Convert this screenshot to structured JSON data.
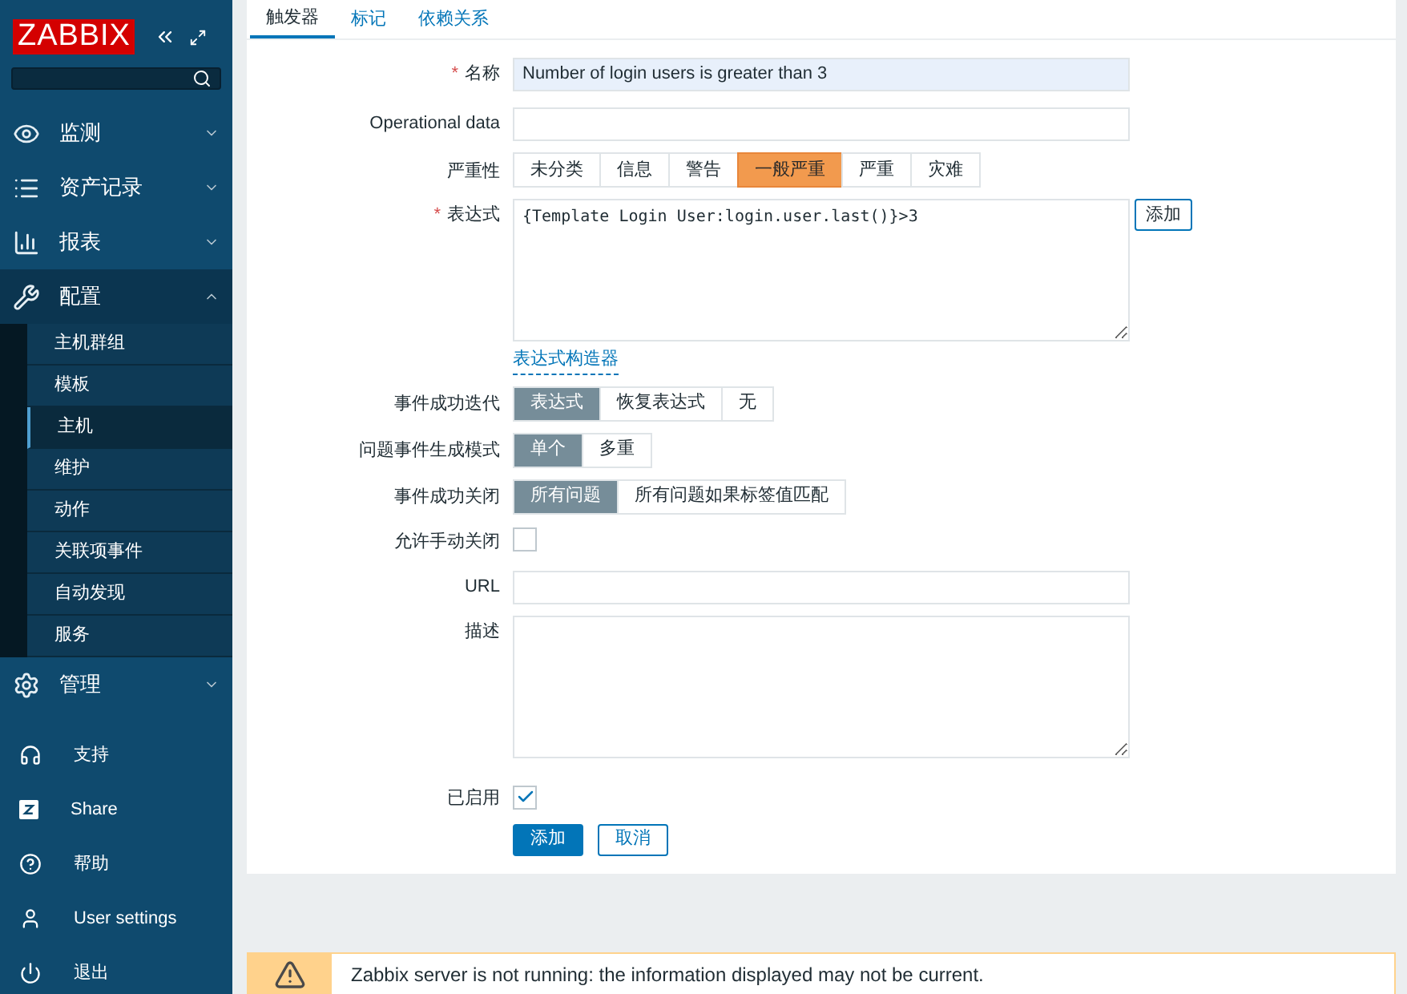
{
  "sidebar": {
    "logo": "ZABBIX",
    "menu": [
      {
        "label": "监测",
        "expanded": false
      },
      {
        "label": "资产记录",
        "expanded": false
      },
      {
        "label": "报表",
        "expanded": false
      },
      {
        "label": "配置",
        "expanded": true,
        "children": [
          {
            "label": "主机群组",
            "selected": false
          },
          {
            "label": "模板",
            "selected": false
          },
          {
            "label": "主机",
            "selected": true
          },
          {
            "label": "维护",
            "selected": false
          },
          {
            "label": "动作",
            "selected": false
          },
          {
            "label": "关联项事件",
            "selected": false
          },
          {
            "label": "自动发现",
            "selected": false
          },
          {
            "label": "服务",
            "selected": false
          }
        ]
      },
      {
        "label": "管理",
        "expanded": false
      }
    ],
    "footer": [
      {
        "label": "支持"
      },
      {
        "label": "Share"
      },
      {
        "label": "帮助"
      },
      {
        "label": "User settings"
      },
      {
        "label": "退出"
      }
    ]
  },
  "tabs": [
    {
      "label": "触发器",
      "selected": true
    },
    {
      "label": "标记",
      "selected": false
    },
    {
      "label": "依赖关系",
      "selected": false
    }
  ],
  "form": [
    {
      "kind": "text",
      "label": "名称",
      "required_mark": "*",
      "value": "Number of login users is greater than 3",
      "focused": true
    },
    {
      "kind": "text",
      "label": "Operational data",
      "focused": false
    },
    {
      "kind": "severity",
      "label": "严重性",
      "options": [
        {
          "label": "未分类",
          "selected": false
        },
        {
          "label": "信息",
          "selected": false
        },
        {
          "label": "警告",
          "selected": false
        },
        {
          "label": "一般严重",
          "selected": true
        },
        {
          "label": "严重",
          "selected": false
        },
        {
          "label": "灾难",
          "selected": false
        }
      ]
    },
    {
      "kind": "expression",
      "label": "表达式",
      "required_mark": "*",
      "value": "{Template Login User:login.user.last()}>3",
      "button": "添加",
      "link": "表达式构造器"
    },
    {
      "kind": "segmented",
      "label": "事件成功迭代",
      "options": [
        {
          "label": "表达式",
          "selected": true
        },
        {
          "label": "恢复表达式",
          "selected": false
        },
        {
          "label": "无",
          "selected": false
        }
      ]
    },
    {
      "kind": "segmented",
      "label": "问题事件生成模式",
      "options": [
        {
          "label": "单个",
          "selected": true
        },
        {
          "label": "多重",
          "selected": false
        }
      ]
    },
    {
      "kind": "segmented",
      "label": "事件成功关闭",
      "options": [
        {
          "label": "所有问题",
          "selected": true
        },
        {
          "label": "所有问题如果标签值匹配",
          "selected": false
        }
      ]
    },
    {
      "kind": "checkbox",
      "label": "允许手动关闭",
      "checked": false
    },
    {
      "kind": "text",
      "label": "URL",
      "focused": false
    },
    {
      "kind": "textarea",
      "label": "描述"
    },
    {
      "kind": "checkbox",
      "label": "已启用",
      "checked": true
    }
  ],
  "buttons": [
    {
      "label": "添加",
      "primary": true
    },
    {
      "label": "取消",
      "primary": false
    }
  ],
  "warning": "Zabbix server is not running: the information displayed may not be current."
}
